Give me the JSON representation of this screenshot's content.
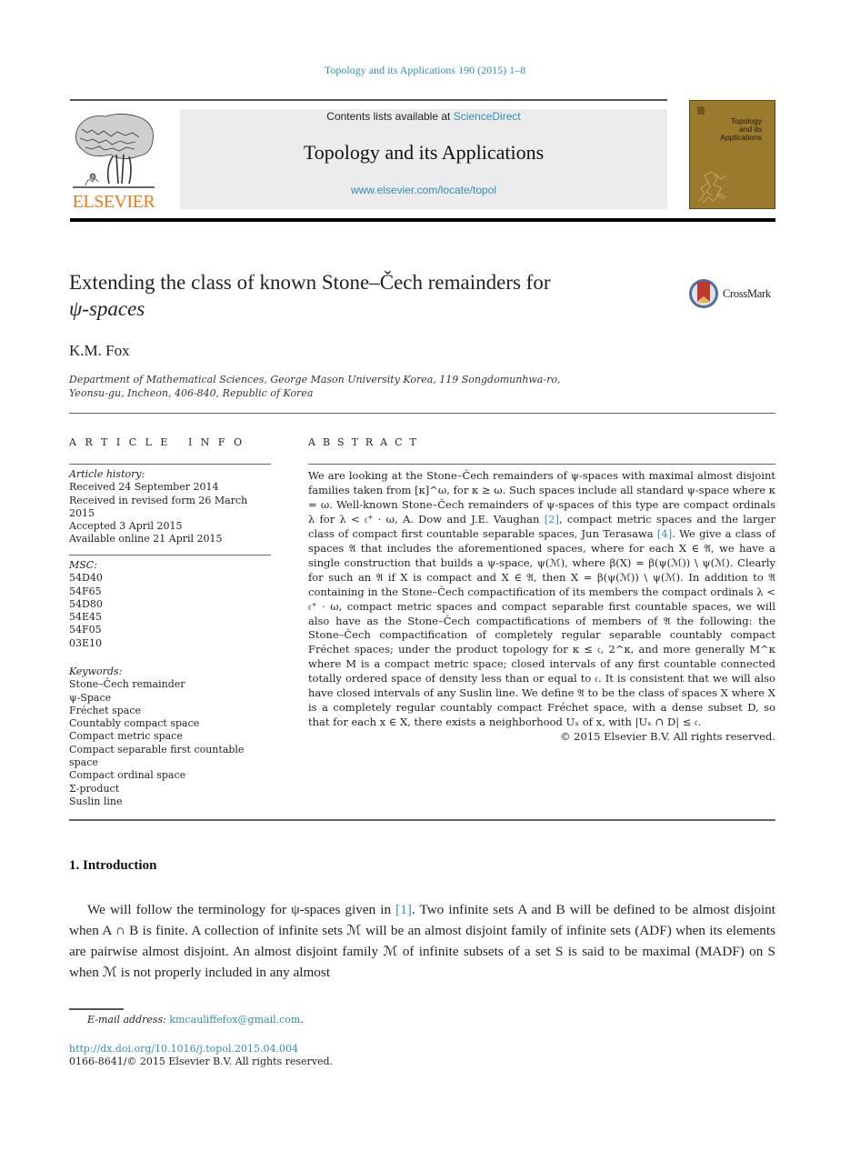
{
  "header": {
    "journal_ref": "Topology and its Applications 190 (2015) 1–8",
    "contents_prefix": "Contents lists available at ",
    "contents_link": "ScienceDirect",
    "journal_title": "Topology and its Applications",
    "journal_url": "www.elsevier.com/locate/topol",
    "publisher_logo_text": "ELSEVIER",
    "cover_title_lines": [
      "Topology",
      "and its",
      "Applications"
    ],
    "colors": {
      "link": "#2e8eb8",
      "elsevier_orange": "#f07a1c",
      "cover": "#9a7a2c"
    }
  },
  "article": {
    "title_line1": "Extending the class of known Stone–Čech remainders for",
    "title_line2": "ψ-spaces",
    "crossmark_label": "CrossMark",
    "author": "K.M. Fox",
    "affiliation_line1": "Department of Mathematical Sciences, George Mason University Korea, 119 Songdomunhwa-ro,",
    "affiliation_line2": "Yeonsu-gu, Incheon, 406-840, Republic of Korea"
  },
  "article_info": {
    "heading": "ARTICLE INFO",
    "history_label": "Article history:",
    "history": [
      "Received 24 September 2014",
      "Received in revised form 26 March 2015",
      "Accepted 3 April 2015",
      "Available online 21 April 2015"
    ],
    "msc_label": "MSC:",
    "msc": [
      "54D40",
      "54F65",
      "54D80",
      "54E45",
      "54F05",
      "03E10"
    ],
    "keywords_label": "Keywords:",
    "keywords": [
      "Stone–Čech remainder",
      "ψ-Space",
      "Fréchet space",
      "Countably compact space",
      "Compact metric space",
      "Compact separable first countable space",
      "Compact ordinal space",
      "Σ-product",
      "Suslin line"
    ]
  },
  "abstract": {
    "heading": "ABSTRACT",
    "p1": "We are looking at the Stone–Čech remainders of ψ-spaces with maximal almost disjoint families taken from [κ]^ω, for κ ≥ ω. Such spaces include all standard ψ-space where κ = ω. Well-known Stone–Čech remainders of ψ-spaces of this type are compact ordinals λ for λ < 𝔠⁺ · ω, A. Dow and J.E. Vaughan ",
    "ref2": "[2]",
    "p2": ", compact metric spaces and the larger class of compact first countable separable spaces, Jun Terasawa ",
    "ref4": "[4]",
    "p3": ". We give a class of spaces 𝔄 that includes the aforementioned spaces, where for each X ∈ 𝔄, we have a single construction that builds a ψ-space, ψ(ℳ), where β(X) = β(ψ(ℳ)) \\ ψ(ℳ). Clearly for such an 𝔄 if X is compact and X ∈ 𝔄, then X = β(ψ(ℳ)) \\ ψ(ℳ). In addition to 𝔄 containing in the Stone–Čech compactification of its members the compact ordinals λ < 𝔠⁺ · ω, compact metric spaces and compact separable first countable spaces, we will also have as the Stone–Čech compactifications of members of 𝔄 the following: the Stone–Čech compactification of completely regular separable countably compact Fréchet spaces; under the product topology for κ ≤ 𝔠, 2^κ, and more generally M^κ where M is a compact metric space; closed intervals of any first countable connected totally ordered space of density less than or equal to 𝔠. It is consistent that we will also have closed intervals of any Suslin line. We define 𝔄 to be the class of spaces X where X is a completely regular countably compact Fréchet space, with a dense subset D, so that for each x ∈ X, there exists a neighborhood Uₓ of x, with |Uₓ ∩ D| ≤ 𝔠.",
    "copyright": "© 2015 Elsevier B.V. All rights reserved."
  },
  "introduction": {
    "heading": "1. Introduction",
    "p_start": "We will follow the terminology for ψ-spaces given in ",
    "ref1": "[1]",
    "p_rest": ". Two infinite sets A and B will be defined to be almost disjoint when A ∩ B is finite. A collection of infinite sets ℳ will be an almost disjoint family of infinite sets (ADF) when its elements are pairwise almost disjoint. An almost disjoint family ℳ of infinite subsets of a set S is said to be maximal (MADF) on S when ℳ is not properly included in any almost"
  },
  "footer": {
    "email_label": "E-mail address:",
    "email": "kmcauliffefox@gmail.com",
    "email_suffix": ".",
    "doi": "http://dx.doi.org/10.1016/j.topol.2015.04.004",
    "issn": "0166-8641/© 2015 Elsevier B.V. All rights reserved."
  }
}
